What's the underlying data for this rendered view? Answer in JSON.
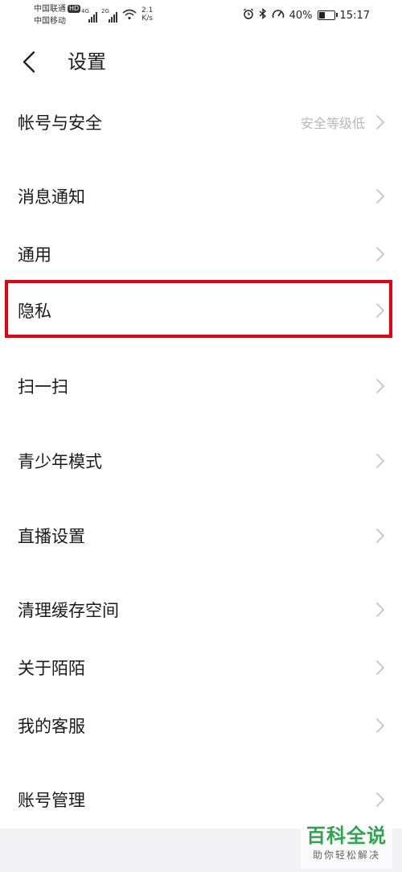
{
  "status_bar": {
    "carrier1": "中国联通",
    "hd_badge": "HD",
    "carrier2": "中国移动",
    "sig1_label": "4G",
    "sig2_label": "2G",
    "speed_value": "2.1",
    "speed_unit": "K/s",
    "battery_percent": "40%",
    "time": "15:17"
  },
  "header": {
    "title": "设置"
  },
  "menu": {
    "items": [
      {
        "label": "帐号与安全",
        "value": "安全等级低"
      },
      {
        "label": "消息通知"
      },
      {
        "label": "通用"
      },
      {
        "label": "隐私"
      },
      {
        "label": "扫一扫"
      },
      {
        "label": "青少年模式"
      },
      {
        "label": "直播设置"
      },
      {
        "label": "清理缓存空间"
      },
      {
        "label": "关于陌陌"
      },
      {
        "label": "我的客服"
      },
      {
        "label": "账号管理"
      }
    ],
    "highlighted_index": 3
  },
  "watermark": {
    "brand": "百科全说",
    "slogan": "助你轻松解决"
  },
  "colors": {
    "highlight": "#e60012",
    "chevron": "#c4c4c4",
    "secondary_text": "#b8b8b8",
    "watermark_green": "#2ea44f"
  }
}
